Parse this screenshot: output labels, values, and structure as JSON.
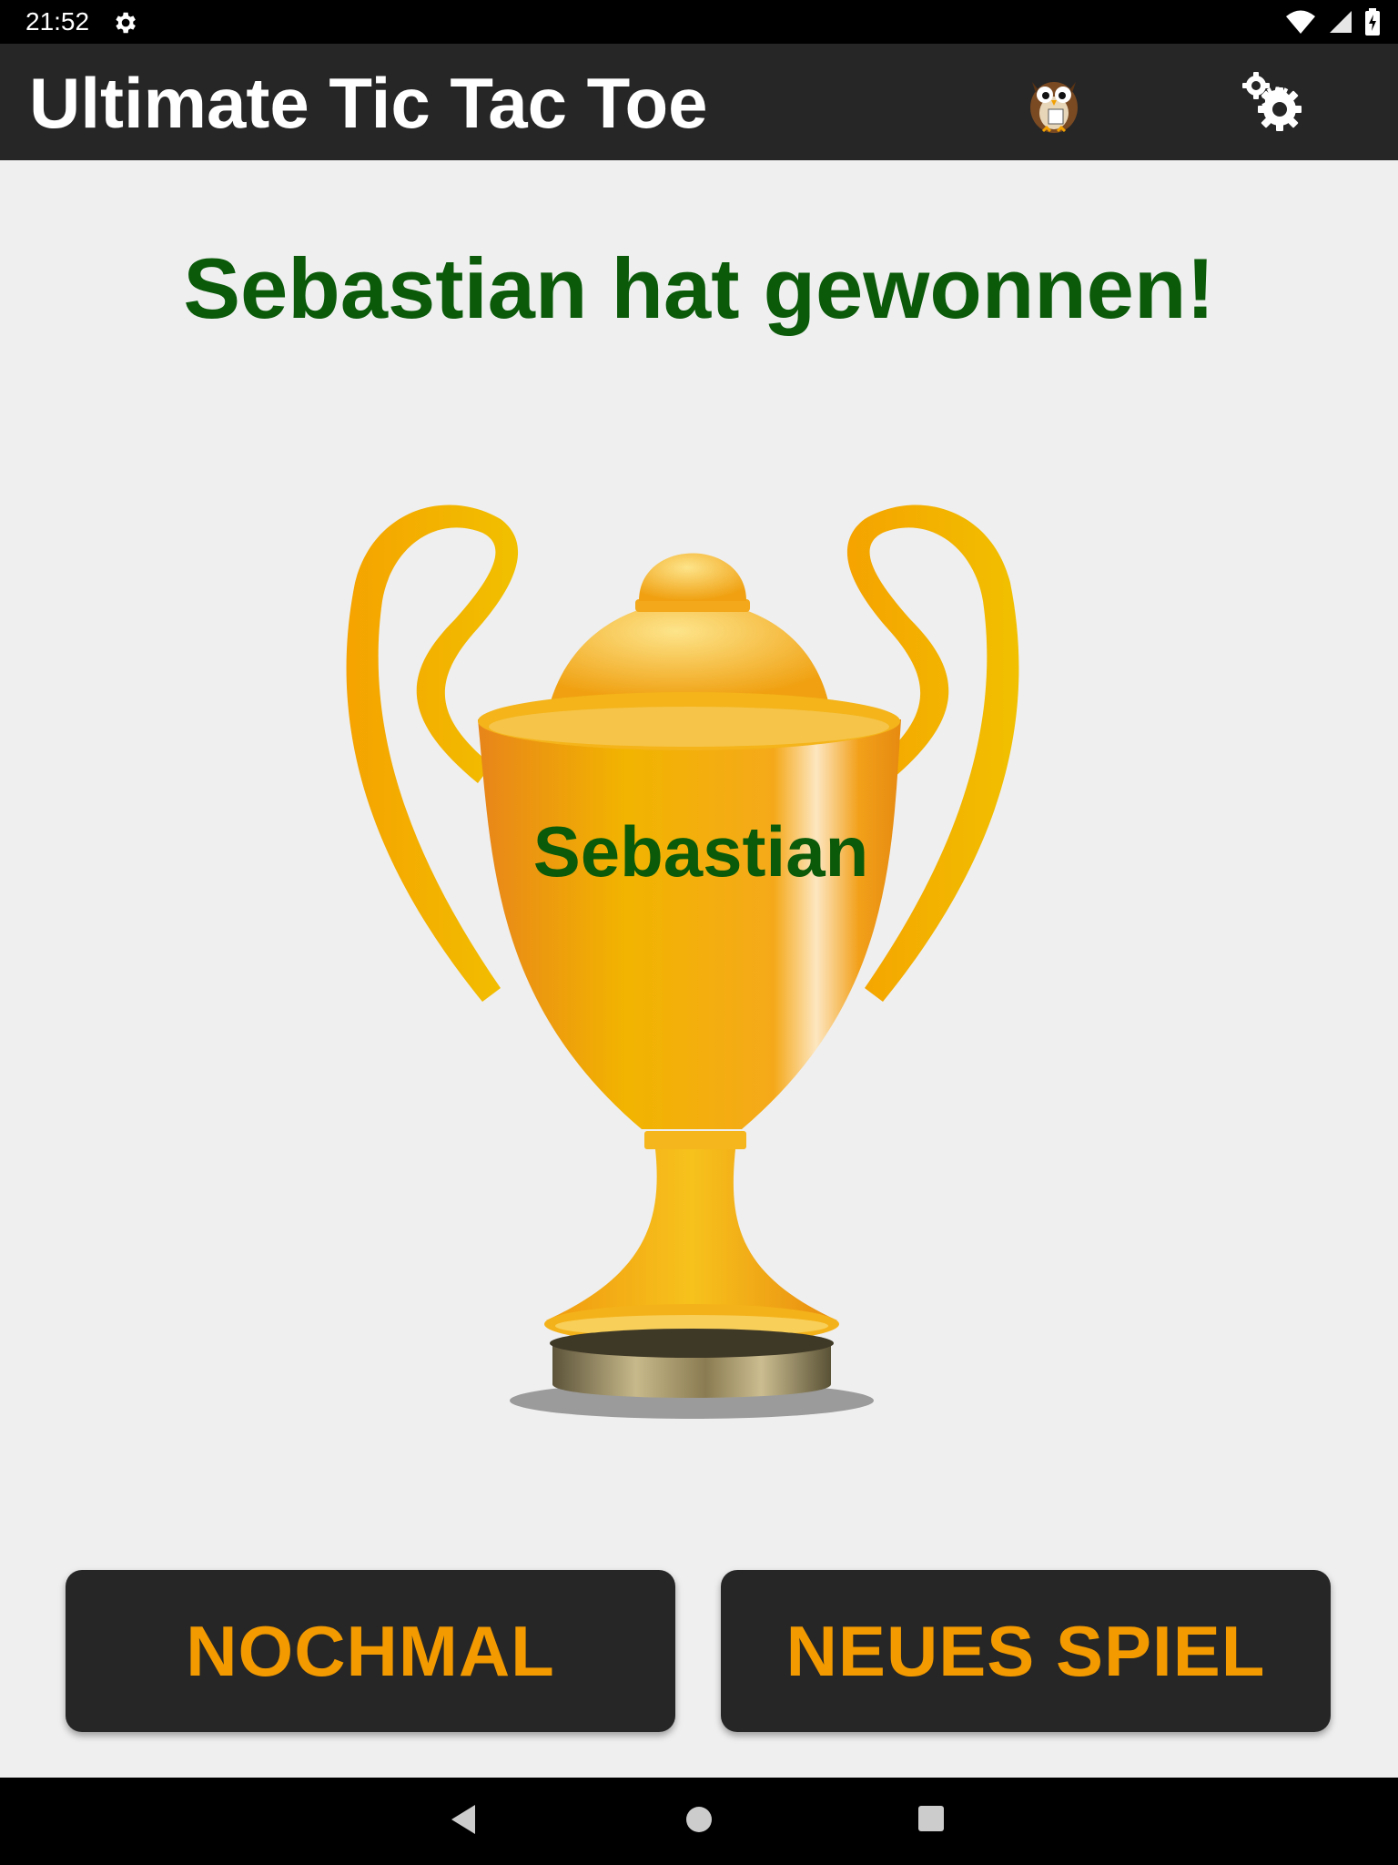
{
  "status_bar": {
    "time": "21:52"
  },
  "toolbar": {
    "title": "Ultimate Tic Tac Toe",
    "icons": [
      "owl-icon",
      "settings-icon"
    ]
  },
  "result": {
    "heading": "Sebastian hat gewonnen!",
    "trophy_name": "Sebastian"
  },
  "actions": {
    "again_label": "NOCHMAL",
    "new_game_label": "NEUES SPIEL"
  },
  "navigation": {
    "icons": [
      "back-icon",
      "home-icon",
      "recents-icon"
    ]
  },
  "colors": {
    "accent": "#f29a00",
    "winner_text": "#0a5a0a",
    "toolbar": "#262626",
    "background": "#efefef"
  }
}
